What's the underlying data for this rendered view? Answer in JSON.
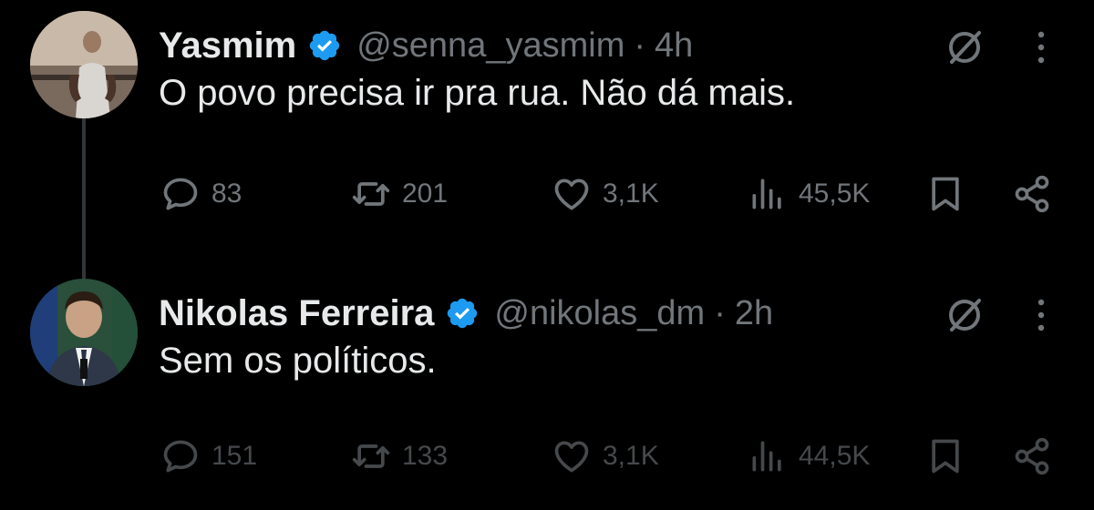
{
  "tweets": [
    {
      "name": "Yasmim",
      "handle": "@senna_yasmim",
      "separator": "·",
      "time": "4h",
      "text": "O povo precisa ir pra rua. Não dá mais.",
      "stats": {
        "replies": "83",
        "retweets": "201",
        "likes": "3,1K",
        "views": "45,5K"
      }
    },
    {
      "name": "Nikolas Ferreira",
      "handle": "@nikolas_dm",
      "separator": "·",
      "time": "2h",
      "text": "Sem os políticos.",
      "stats": {
        "replies": "151",
        "retweets": "133",
        "likes": "3,1K",
        "views": "44,5K"
      }
    }
  ],
  "icons": {
    "verified": "verified-badge-icon",
    "grok": "grok-icon",
    "more": "more-vertical-icon",
    "reply": "reply-bubble-icon",
    "retweet": "retweet-icon",
    "like": "heart-icon",
    "views": "views-bars-icon",
    "bookmark": "bookmark-icon",
    "share": "share-icon"
  },
  "colors": {
    "background": "#000000",
    "primary_text": "#e7e9ea",
    "secondary_text": "#71767b",
    "verified_blue": "#1d9bf0",
    "thread_line": "#333639"
  }
}
